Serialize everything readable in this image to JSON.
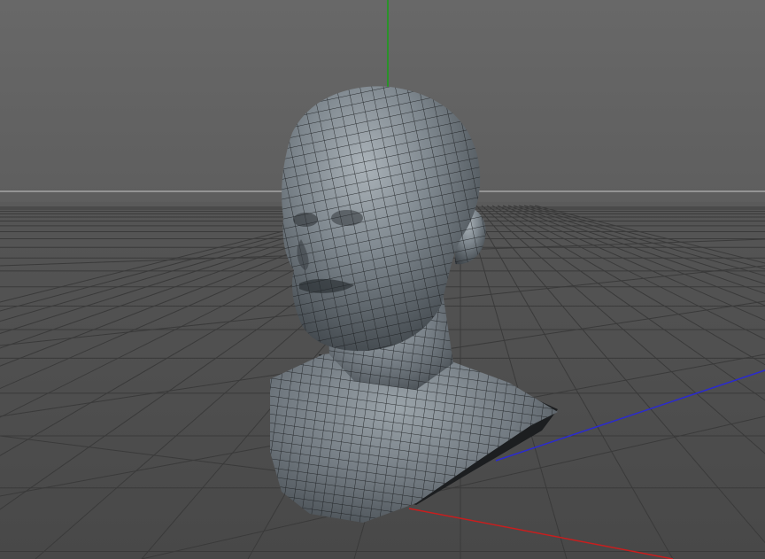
{
  "viewport": {
    "background_top": "#666666",
    "background_bottom": "#4a4a4a",
    "grid_color": "#3a3a3a",
    "horizon_color": "#a0a0a0"
  },
  "axes": {
    "x_color": "#c81e1e",
    "y_color": "#16a016",
    "z_color": "#2a2ad0"
  },
  "model": {
    "icon": "head-bust-mesh",
    "surface_color": "#7c858c",
    "wire_color": "#1a1c1f",
    "shadow_color": "#1c1e20"
  }
}
